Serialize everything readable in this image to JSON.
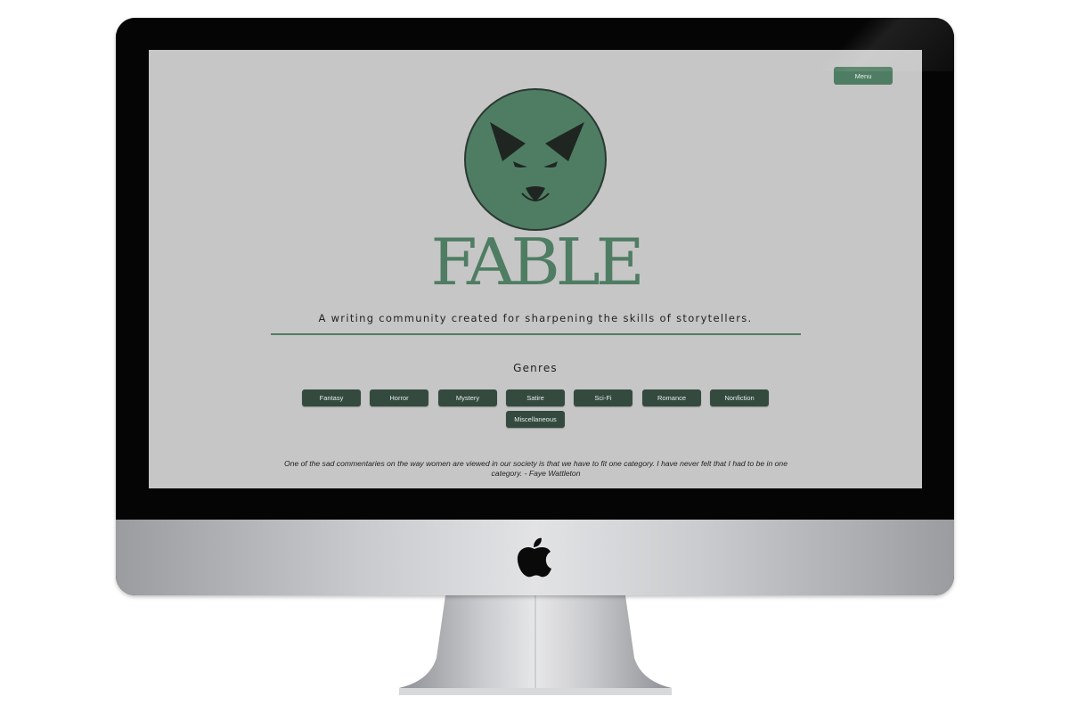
{
  "header": {
    "menu_label": "Menu"
  },
  "brand": {
    "name": "FABLE",
    "tagline": "A writing community created for sharpening the skills of storytellers.",
    "logo_icon": "fox-head-icon"
  },
  "genres": {
    "heading": "Genres",
    "items": [
      {
        "label": "Fantasy"
      },
      {
        "label": "Horror"
      },
      {
        "label": "Mystery"
      },
      {
        "label": "Satire"
      },
      {
        "label": "Sci-Fi"
      },
      {
        "label": "Romance"
      },
      {
        "label": "Nonfiction"
      },
      {
        "label": "Miscellaneous"
      }
    ]
  },
  "quote": {
    "text": "One of the sad commentaries on the way women are viewed in our society is that we have to fit one category. I have never felt that I had to be in one category. - Faye Wattleton"
  },
  "device": {
    "chin_icon": "apple-logo-icon"
  },
  "colors": {
    "accent": "#4f7d63",
    "button_dark": "#344a3f",
    "screen_background": "#c6c6c6"
  }
}
